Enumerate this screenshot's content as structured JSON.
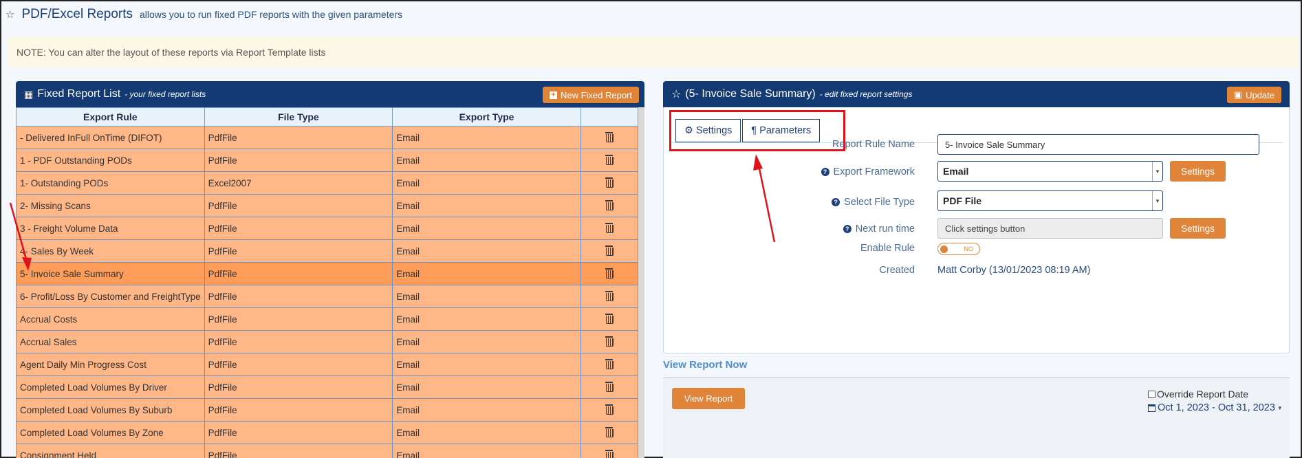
{
  "header": {
    "title": "PDF/Excel Reports",
    "subtitle": "allows you to run fixed PDF reports with the given parameters"
  },
  "note": "NOTE: You can alter the layout of these reports via Report Template lists",
  "list_panel": {
    "title": "Fixed Report List",
    "subtitle": "- your fixed report lists",
    "new_button": "New Fixed Report",
    "columns": [
      "Export Rule",
      "File Type",
      "Export Type",
      ""
    ],
    "rows": [
      {
        "rule": "- Delivered InFull OnTime (DIFOT)",
        "file_type": "PdfFile",
        "export_type": "Email",
        "selected": false
      },
      {
        "rule": "1 - PDF Outstanding PODs",
        "file_type": "PdfFile",
        "export_type": "Email",
        "selected": false
      },
      {
        "rule": "1- Outstanding PODs",
        "file_type": "Excel2007",
        "export_type": "Email",
        "selected": false
      },
      {
        "rule": "2- Missing Scans",
        "file_type": "PdfFile",
        "export_type": "Email",
        "selected": false
      },
      {
        "rule": "3 - Freight Volume Data",
        "file_type": "PdfFile",
        "export_type": "Email",
        "selected": false
      },
      {
        "rule": "4- Sales By Week",
        "file_type": "PdfFile",
        "export_type": "Email",
        "selected": false
      },
      {
        "rule": "5- Invoice Sale Summary",
        "file_type": "PdfFile",
        "export_type": "Email",
        "selected": true
      },
      {
        "rule": "6- Profit/Loss By Customer and FreightType",
        "file_type": "PdfFile",
        "export_type": "Email",
        "selected": false
      },
      {
        "rule": "Accrual Costs",
        "file_type": "PdfFile",
        "export_type": "Email",
        "selected": false
      },
      {
        "rule": "Accrual Sales",
        "file_type": "PdfFile",
        "export_type": "Email",
        "selected": false
      },
      {
        "rule": "Agent Daily Min Progress Cost",
        "file_type": "PdfFile",
        "export_type": "Email",
        "selected": false
      },
      {
        "rule": "Completed Load Volumes By Driver",
        "file_type": "PdfFile",
        "export_type": "Email",
        "selected": false
      },
      {
        "rule": "Completed Load Volumes By Suburb",
        "file_type": "PdfFile",
        "export_type": "Email",
        "selected": false
      },
      {
        "rule": "Completed Load Volumes By Zone",
        "file_type": "PdfFile",
        "export_type": "Email",
        "selected": false
      },
      {
        "rule": "Consignment Held",
        "file_type": "PdfFile",
        "export_type": "Email",
        "selected": false
      }
    ]
  },
  "detail_panel": {
    "title": "(5- Invoice Sale Summary)",
    "subtitle": "- edit fixed report settings",
    "update_button": "Update",
    "tabs": [
      {
        "label": "Settings",
        "icon": "gear-icon"
      },
      {
        "label": "Parameters",
        "icon": "pilcrow-icon"
      }
    ],
    "fields": {
      "rule_name_label": "Report Rule Name",
      "rule_name_value": "5- Invoice Sale Summary",
      "framework_label": "Export Framework",
      "framework_value": "Email",
      "file_type_label": "Select File Type",
      "file_type_value": "PDF File",
      "next_run_label": "Next run time",
      "next_run_value": "Click settings button",
      "settings_button": "Settings",
      "enable_label": "Enable Rule",
      "enable_state": "NO",
      "created_label": "Created",
      "created_value": "Matt Corby (13/01/2023 08:19 AM)"
    }
  },
  "view_report": {
    "heading": "View Report Now",
    "button": "View Report",
    "override_label": "Override Report Date",
    "date_range": "Oct 1, 2023 - Oct 31, 2023"
  },
  "colors": {
    "header_navy": "#133a73",
    "accent_orange": "#e0843a",
    "row_orange": "#ffb787",
    "row_selected": "#ff9c59",
    "annotation_red": "#e0121a"
  }
}
